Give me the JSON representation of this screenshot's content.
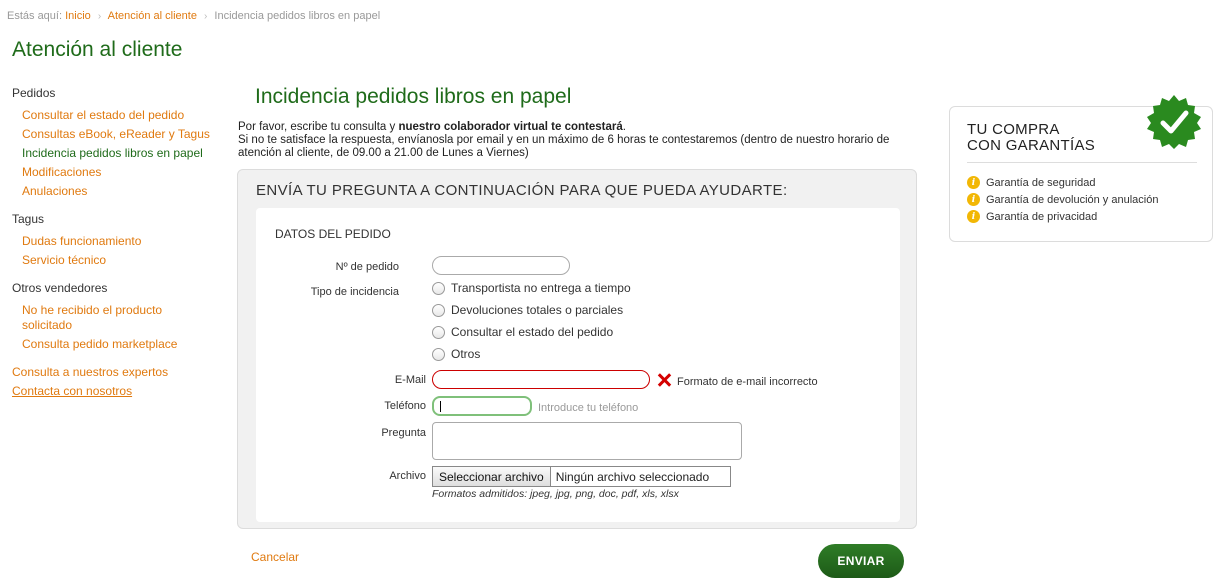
{
  "breadcrumb": {
    "prefix": "Estás aquí:",
    "home": "Inicio",
    "section": "Atención al cliente",
    "current": "Incidencia pedidos libros en papel"
  },
  "page_title": "Atención al cliente",
  "sidebar": {
    "groups": [
      {
        "title": "Pedidos",
        "items": [
          "Consultar el estado del pedido",
          "Consultas eBook, eReader y Tagus",
          "Incidencia pedidos libros en papel",
          "Modificaciones",
          "Anulaciones"
        ]
      },
      {
        "title": "Tagus",
        "items": [
          "Dudas funcionamiento",
          "Servicio técnico"
        ]
      },
      {
        "title": "Otros vendedores",
        "items": [
          "No he recibido el producto solicitado",
          "Consulta pedido marketplace"
        ]
      }
    ],
    "extra_links": [
      "Consulta a nuestros expertos",
      "Contacta con nosotros"
    ]
  },
  "main": {
    "title": "Incidencia pedidos libros en papel",
    "intro_line1_pre": "Por favor, escribe tu consulta y ",
    "intro_line1_bold": "nuestro colaborador virtual te contestará",
    "intro_line1_post": ".",
    "intro_line2": "Si no te satisface la respuesta, envíanosla por email y en un máximo de 6 horas te contestaremos (dentro de nuestro horario de atención al cliente, de 09.00 a 21.00 de Lunes a Viernes)"
  },
  "form": {
    "heading": "ENVÍA TU PREGUNTA A CONTINUACIÓN PARA QUE PUEDA AYUDARTE:",
    "section_title": "DATOS DEL PEDIDO",
    "order_label": "Nº de pedido",
    "order_value": "",
    "incident_label": "Tipo de incidencia",
    "incident_options": [
      "Transportista no entrega a tiempo",
      "Devoluciones totales o parciales",
      "Consultar el estado del pedido",
      "Otros"
    ],
    "email_label": "E-Mail",
    "email_value": "",
    "email_error": "Formato de e-mail incorrecto",
    "phone_label": "Teléfono",
    "phone_value": "",
    "phone_hint": "Introduce tu teléfono",
    "question_label": "Pregunta",
    "question_value": "",
    "file_label": "Archivo",
    "file_button": "Seleccionar archivo",
    "file_status": "Ningún archivo seleccionado",
    "formats": "Formatos admitidos: jpeg, jpg, png, doc, pdf, xls, xlsx"
  },
  "actions": {
    "cancel": "Cancelar",
    "send": "ENVIAR"
  },
  "guarantee": {
    "title_line1": "TU COMPRA",
    "title_line2": "CON GARANTÍAS",
    "items": [
      "Garantía de seguridad",
      "Garantía de devolución y anulación",
      "Garantía de privacidad"
    ]
  },
  "colors": {
    "brand_green": "#1f6b1a",
    "link_orange": "#e07a10",
    "error_red": "#cc0000",
    "info_yellow": "#f2b705"
  }
}
